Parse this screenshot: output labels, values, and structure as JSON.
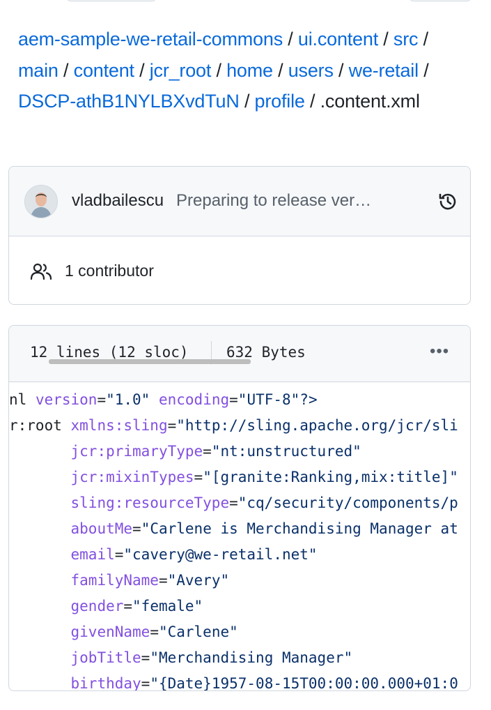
{
  "breadcrumb": {
    "items": [
      "aem-sample-we-retail-commons",
      "ui.content",
      "src",
      "main",
      "content",
      "jcr_root",
      "home",
      "users",
      "we-retail",
      "DSCP-athB1NYLBXvdTuN",
      "profile"
    ],
    "separator": "/",
    "current": ".content.xml"
  },
  "commit": {
    "author": "vladbailescu",
    "message": "Preparing to release ver…",
    "history_icon": "history-icon",
    "contributors_text": "1 contributor",
    "contributors_icon": "people-icon"
  },
  "file": {
    "lines_info": "12 lines (12 sloc)",
    "size": "632 Bytes",
    "menu_icon": "kebab-horizontal-icon",
    "menu_label": "•••"
  },
  "code_lines": [
    {
      "indent": "",
      "parts": [
        [
          "plain",
          "nl "
        ],
        [
          "attr",
          "version"
        ],
        [
          "plain",
          "="
        ],
        [
          "str",
          "\"1.0\""
        ],
        [
          "plain",
          " "
        ],
        [
          "attr",
          "encoding"
        ],
        [
          "plain",
          "="
        ],
        [
          "str",
          "\"UTF-8\"?>"
        ]
      ]
    },
    {
      "indent": "",
      "parts": [
        [
          "plain",
          "r:root "
        ],
        [
          "attr",
          "xmlns:sling"
        ],
        [
          "plain",
          "="
        ],
        [
          "str",
          "\"http://sling.apache.org/jcr/sli"
        ]
      ]
    },
    {
      "indent": "       ",
      "parts": [
        [
          "attr",
          "jcr:primaryType"
        ],
        [
          "plain",
          "="
        ],
        [
          "str",
          "\"nt:unstructured\""
        ]
      ]
    },
    {
      "indent": "       ",
      "parts": [
        [
          "attr",
          "jcr:mixinTypes"
        ],
        [
          "plain",
          "="
        ],
        [
          "str",
          "\"[granite:Ranking,mix:title]\""
        ]
      ]
    },
    {
      "indent": "       ",
      "parts": [
        [
          "attr",
          "sling:resourceType"
        ],
        [
          "plain",
          "="
        ],
        [
          "str",
          "\"cq/security/components/p"
        ]
      ]
    },
    {
      "indent": "       ",
      "parts": [
        [
          "attr",
          "aboutMe"
        ],
        [
          "plain",
          "="
        ],
        [
          "str",
          "\"Carlene is Merchandising Manager at"
        ]
      ]
    },
    {
      "indent": "       ",
      "parts": [
        [
          "attr",
          "email"
        ],
        [
          "plain",
          "="
        ],
        [
          "str",
          "\"cavery@we-retail.net\""
        ]
      ]
    },
    {
      "indent": "       ",
      "parts": [
        [
          "attr",
          "familyName"
        ],
        [
          "plain",
          "="
        ],
        [
          "str",
          "\"Avery\""
        ]
      ]
    },
    {
      "indent": "       ",
      "parts": [
        [
          "attr",
          "gender"
        ],
        [
          "plain",
          "="
        ],
        [
          "str",
          "\"female\""
        ]
      ]
    },
    {
      "indent": "       ",
      "parts": [
        [
          "attr",
          "givenName"
        ],
        [
          "plain",
          "="
        ],
        [
          "str",
          "\"Carlene\""
        ]
      ]
    },
    {
      "indent": "       ",
      "parts": [
        [
          "attr",
          "jobTitle"
        ],
        [
          "plain",
          "="
        ],
        [
          "str",
          "\"Merchandising Manager\""
        ]
      ]
    },
    {
      "indent": "       ",
      "parts": [
        [
          "attr",
          "birthday"
        ],
        [
          "plain",
          "="
        ],
        [
          "str",
          "\"{Date}1957-08-15T00:00:00.000+01:0"
        ]
      ]
    }
  ]
}
